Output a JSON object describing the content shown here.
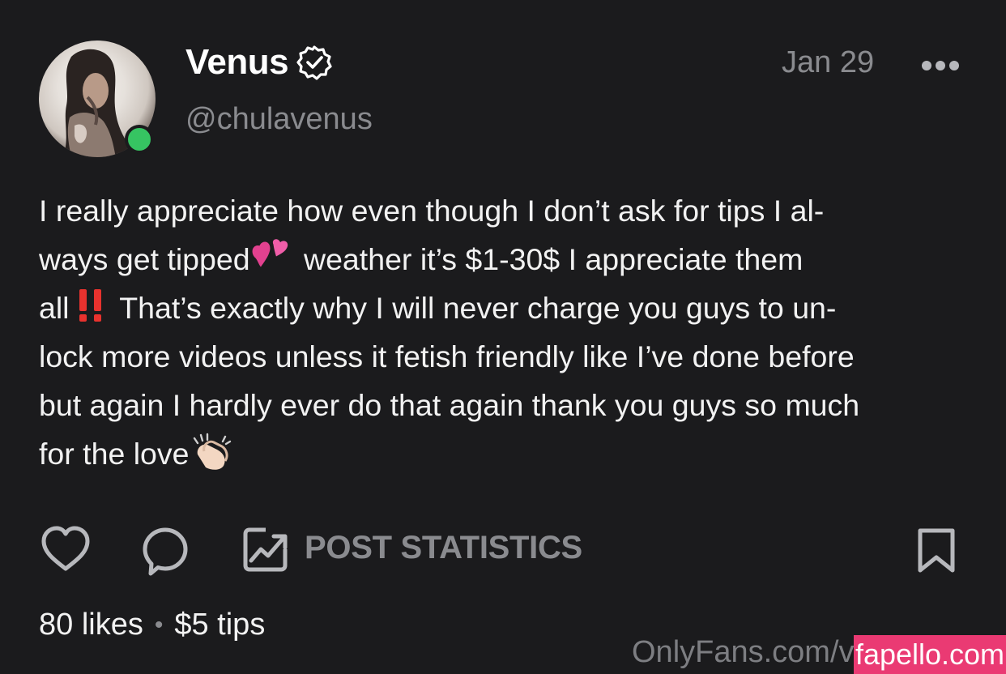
{
  "post": {
    "author_name": "Venus",
    "author_handle": "@chulavenus",
    "date": "Jan 29",
    "online_status": "online",
    "text_lines": [
      "I really appreciate how even though I don’t ask for tips I al-",
      "ways get tipped",
      " weather it’s $1-30$ I appreciate them",
      "all",
      " That’s exactly why I will never charge you guys to un-",
      "lock more videos unless it fetish friendly like I’ve done before",
      "but again I hardly ever do that again thank you guys so much",
      "for the love"
    ],
    "emojis": [
      "two-hearts-emoji",
      "double-exclamation-emoji",
      "clapping-hands-emoji"
    ]
  },
  "actions": {
    "like_icon": "heart-icon",
    "comment_icon": "comment-icon",
    "stats_icon": "chart-icon",
    "stats_label": "POST STATISTICS",
    "bookmark_icon": "bookmark-icon"
  },
  "footer": {
    "likes": "80 likes",
    "separator": "•",
    "tips": "$5 tips"
  },
  "watermarks": {
    "onlyfans": "OnlyFans.com/venus",
    "fapello": "fapello.com"
  },
  "colors": {
    "background": "#1b1b1d",
    "muted": "#8a8b8f",
    "online": "#36c462",
    "fapello": "#ea3a73"
  }
}
